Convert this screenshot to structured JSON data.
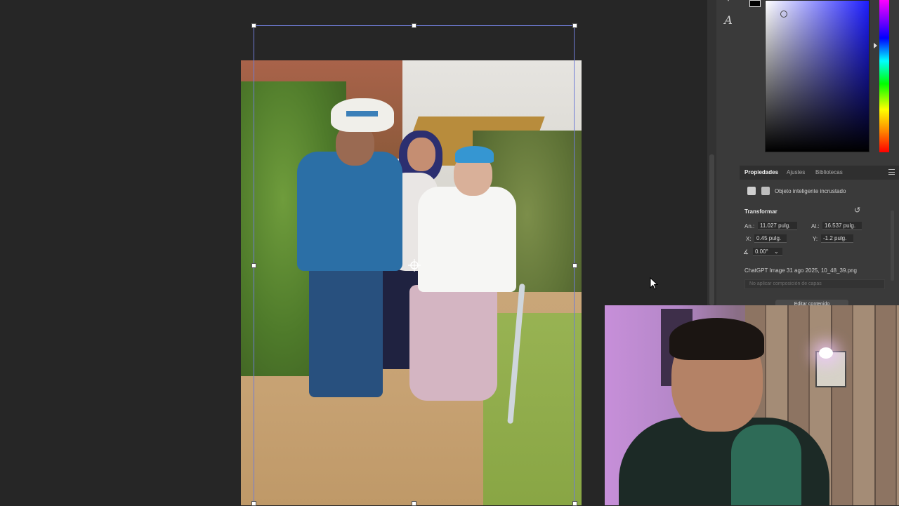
{
  "panel_tabs": [
    "Propiedades",
    "Ajustes",
    "Bibliotecas"
  ],
  "properties": {
    "layer_type": "Objeto inteligente incrustado",
    "transform_heading": "Transformar",
    "width_label": "An.:",
    "width_value": "11.027 pulg.",
    "height_label": "Al.:",
    "height_value": "16.537 pulg.",
    "x_label": "X:",
    "x_value": "0.45 pulg.",
    "y_label": "Y:",
    "y_value": "-1.2 pulg.",
    "angle_value": "0.00°",
    "filename": "ChatGPT Image 31 ago 2025, 10_48_39.png",
    "composition_placeholder": "No aplicar composición de capas",
    "edit_button": "Editar contenido"
  },
  "tools": {
    "text_tool_glyph": "A"
  },
  "colors": {
    "panel_bg": "#3a3a3a",
    "canvas_bg": "#262626",
    "transform_box": "#6f7cd6",
    "foreground_color": "#000000"
  }
}
